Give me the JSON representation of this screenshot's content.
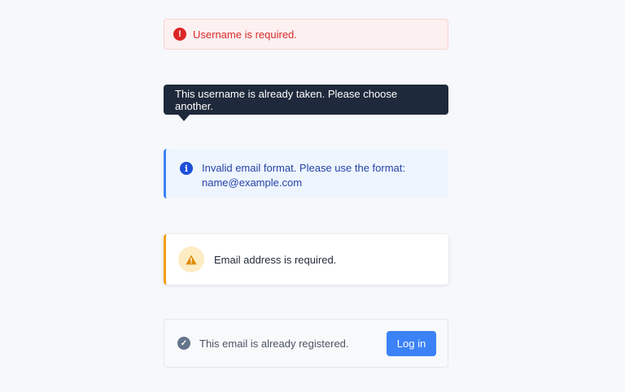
{
  "alerts": {
    "username_required": {
      "text": "Username is required.",
      "icon": "exclamation-circle-icon",
      "color": "#dc2626"
    },
    "username_taken_tooltip": {
      "text": "This username is already taken. Please choose another."
    },
    "invalid_email": {
      "text": "Invalid email format. Please use the format: name@example.com",
      "icon": "info-circle-icon",
      "color": "#3b82f6"
    },
    "email_required": {
      "text": "Email address is required.",
      "icon": "warning-triangle-icon",
      "color": "#f59e0b"
    },
    "email_registered": {
      "text": "This email is already registered.",
      "icon": "check-circle-icon",
      "button_label": "Log in",
      "button_color": "#3b82f6"
    }
  }
}
